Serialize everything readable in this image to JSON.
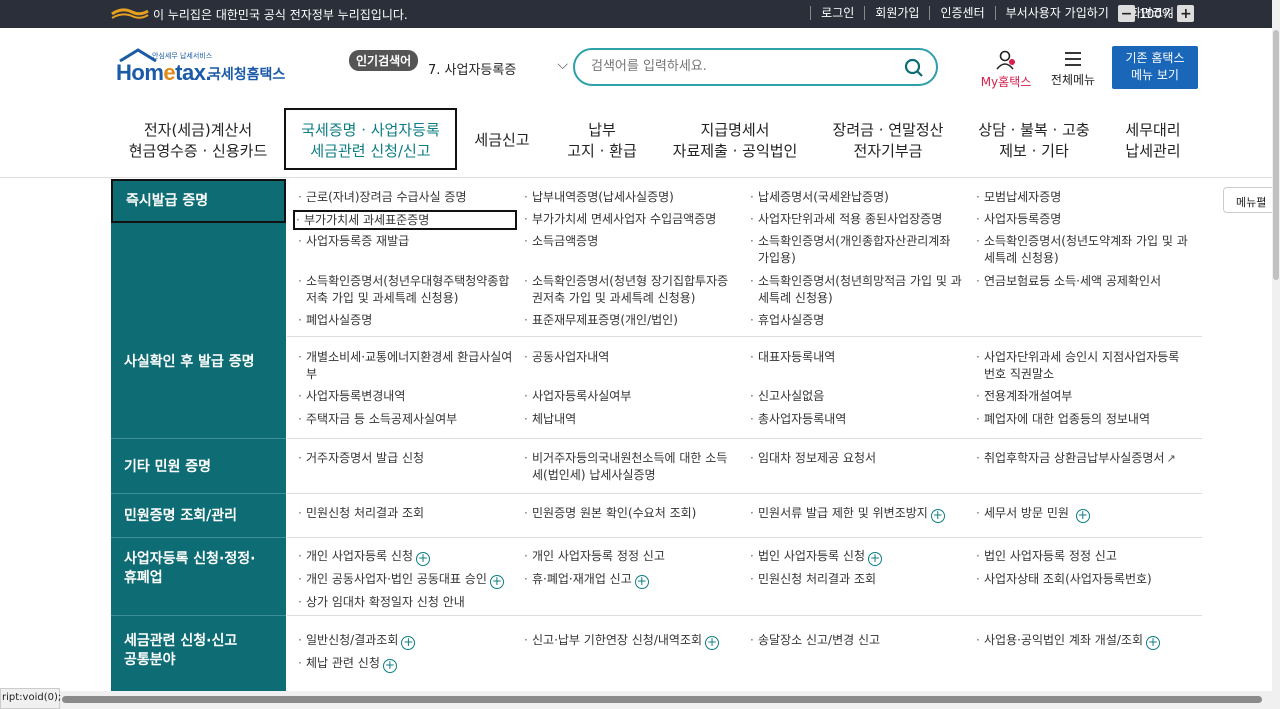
{
  "govbar": {
    "notice": "이 누리집은 대한민국 공식 전자정부 누리집입니다.",
    "links": [
      "로그인",
      "회원가입",
      "인증센터",
      "부서사용자 가입하기",
      "화면크기"
    ],
    "zoom_minus": "−",
    "zoom_value": "100%",
    "zoom_plus": "+"
  },
  "header": {
    "brand_sub": "안심세무 납세서비스",
    "brand_home": "Hom",
    "brand_e": "e",
    "brand_tax": "tax.",
    "brand_kr": "국세청홈택스",
    "popular_label": "인기검색어",
    "popular_value": "7.  사업자등록증",
    "search_placeholder": "검색어를 입력하세요.",
    "my_label": "My홈택스",
    "allmenu_label": "전체메뉴",
    "old_btn_line1": "기존 홈택스",
    "old_btn_line2": "메뉴 보기"
  },
  "gnb": [
    {
      "l1": "전자(세금)계산서",
      "l2": "현금영수증 · 신용카드"
    },
    {
      "l1": "국세증명 · 사업자등록",
      "l2": "세금관련 신청/신고"
    },
    {
      "l1": "세금신고",
      "l2": ""
    },
    {
      "l1": "납부",
      "l2": "고지 · 환급"
    },
    {
      "l1": "지급명세서",
      "l2": "자료제출 · 공익법인"
    },
    {
      "l1": "장려금 · 연말정산",
      "l2": "전자기부금"
    },
    {
      "l1": "상담 · 불복 · 고충",
      "l2": "제보 · 기타"
    },
    {
      "l1": "세무대리",
      "l2": "납세관리"
    }
  ],
  "sidebar": [
    {
      "label": "즉시발급 증명"
    },
    {
      "label": "사실확인 후 발급 증명"
    },
    {
      "label": "기타 민원 증명"
    },
    {
      "label": "민원증명 조회/관리"
    },
    {
      "label": "사업자등록 신청·정정·휴폐업"
    },
    {
      "label": "세금관련 신청·신고 공통분야"
    }
  ],
  "sections": {
    "s1": [
      "근로(자녀)장려금 수급사실 증명",
      "납부내역증명(납세사실증명)",
      "납세증명서(국세완납증명)",
      "모범납세자증명",
      "부가가치세 과세표준증명",
      "부가가치세 면세사업자 수입금액증명",
      "사업자단위과세 적용 종된사업장증명",
      "사업자등록증명",
      "사업자등록증 재발급",
      "소득금액증명",
      "소득확인증명서(개인종합자산관리계좌 가입용)",
      "소득확인증명서(청년도약계좌 가입 및 과세특례 신청용)",
      "소득확인증명서(청년우대형주택청약종합저축 가입 및 과세특례 신청용)",
      "소득확인증명서(청년형 장기집합투자증권저축 가입 및 과세특례 신청용)",
      "소득확인증명서(청년희망적금 가입 및 과세특례 신청용)",
      "연금보험료등 소득·세액 공제확인서",
      "폐업사실증명",
      "표준재무제표증명(개인/법인)",
      "휴업사실증명"
    ],
    "s2": [
      "개별소비세·교통에너지환경세 환급사실여부",
      "공동사업자내역",
      "대표자등록내역",
      "사업자단위과세 승인시 지점사업자등록번호 직권말소",
      "사업자등록변경내역",
      "사업자등록사실여부",
      "신고사실없음",
      "전용계좌개설여부",
      "주택자금 등 소득공제사실여부",
      "체납내역",
      "총사업자등록내역",
      "폐업자에 대한 업종등의 정보내역"
    ],
    "s3": [
      "거주자증명서 발급 신청",
      "비거주자등의국내원천소득에 대한 소득세(법인세) 납세사실증명",
      "임대차 정보제공 요청서",
      "취업후학자금 상환금납부사실증명서"
    ],
    "s4": [
      "민원신청 처리결과 조회",
      "민원증명 원본 확인(수요처 조회)",
      "민원서류 발급 제한 및 위변조방지",
      "세무서 방문 민원"
    ],
    "s5": [
      "개인 사업자등록 신청",
      "개인 사업자등록 정정 신고",
      "법인 사업자등록 신청",
      "법인 사업자등록 정정 신고",
      "개인 공동사업자·법인 공동대표 승인",
      "휴·폐업·재개업 신고",
      "민원신청 처리결과 조회",
      "사업자상태 조회(사업자등록번호)",
      "상가 임대차 확정일자 신청 안내"
    ],
    "s6": [
      "일반신청/결과조회",
      "신고·납부 기한연장 신청/내역조회",
      "송달장소 신고/변경 신고",
      "사업용·공익법인 계좌 개설/조회",
      "체납 관련 신청"
    ]
  },
  "menufold": "메뉴펼",
  "statusbar": "ript:void(0);",
  "colors": {
    "teal": "#0d6c74",
    "accent": "#2ea0a8",
    "brand": "#1a5aa6",
    "my": "#d6204a"
  }
}
